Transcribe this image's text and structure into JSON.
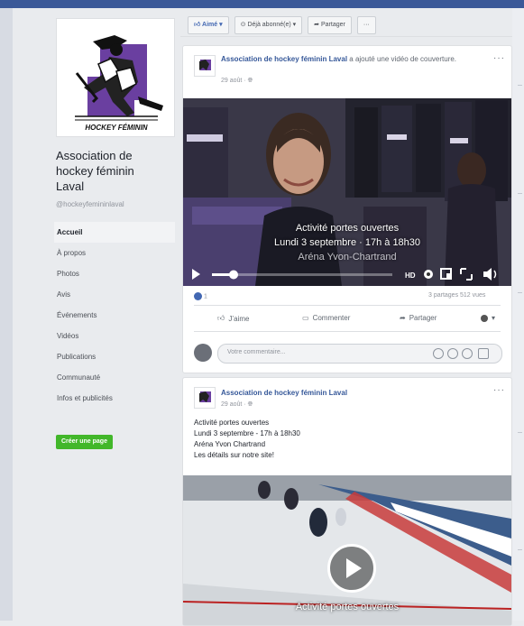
{
  "page": {
    "name": "Association de hockey féminin Laval",
    "name_lines": [
      "Association de",
      "hockey féminin",
      "Laval"
    ],
    "handle": "@hockeyfemininlaval",
    "logo_text": "HOCKEY FÉMININ",
    "create_page_label": "Créer une page"
  },
  "nav": [
    {
      "label": "Accueil",
      "active": true
    },
    {
      "label": "À propos"
    },
    {
      "label": "Photos"
    },
    {
      "label": "Avis"
    },
    {
      "label": "Événements"
    },
    {
      "label": "Vidéos"
    },
    {
      "label": "Publications"
    },
    {
      "label": "Communauté"
    },
    {
      "label": "Infos et publicités"
    }
  ],
  "actions": {
    "like": "Aimé",
    "subscribed": "Déjà abonné(e)",
    "share": "Partager",
    "more": "···"
  },
  "post1": {
    "author": "Association de hockey féminin Laval",
    "action": "a ajouté une vidéo de couverture.",
    "date": "29 août",
    "video": {
      "overlay_line1": "Activité portes ouvertes",
      "overlay_line2": "Lundi 3 septembre · 17h à 18h30",
      "overlay_line3": "Aréna Yvon-Chartrand",
      "quality": "HD",
      "progress": 0.12
    },
    "reaction_count": "1",
    "stats": "3 partages  512 vues",
    "like_label": "J’aime",
    "comment_label": "Commenter",
    "share_label": "Partager",
    "comment_placeholder": "Votre commentaire..."
  },
  "post2": {
    "author": "Association de hockey féminin Laval",
    "date": "29 août",
    "text": [
      "Activité portes ouvertes",
      "Lundi 3 septembre - 17h à 18h30",
      "Aréna Yvon Chartrand",
      "Les détails sur notre site!"
    ],
    "video_caption": "Activité portes ouvertes"
  },
  "colors": {
    "brand": "#3b5998",
    "link": "#365899",
    "create_button": "#42b72a",
    "logo_purple": "#6a3fa0"
  }
}
